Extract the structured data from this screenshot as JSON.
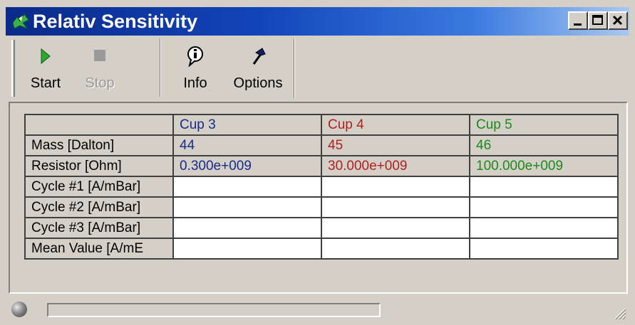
{
  "window": {
    "title": "Relativ Sensitivity",
    "controls": [
      "minimize",
      "maximize",
      "close"
    ]
  },
  "toolbar": {
    "buttons": [
      {
        "label": "Start",
        "icon": "play-icon",
        "enabled": true
      },
      {
        "label": "Stop",
        "icon": "stop-icon",
        "enabled": false
      },
      {
        "label": "Info",
        "icon": "info-icon",
        "enabled": true
      },
      {
        "label": "Options",
        "icon": "hammer-icon",
        "enabled": true
      }
    ]
  },
  "table": {
    "columns": [
      {
        "label": "Cup 3",
        "color": "#1a2a8a"
      },
      {
        "label": "Cup 4",
        "color": "#b02020"
      },
      {
        "label": "Cup 5",
        "color": "#1a8a1a"
      }
    ],
    "rows": [
      {
        "label": "Mass [Dalton]",
        "values": [
          "44",
          "45",
          "46"
        ],
        "style": "header"
      },
      {
        "label": "Resistor [Ohm]",
        "values": [
          "0.300e+009",
          "30.000e+009",
          "100.000e+009"
        ],
        "style": "header"
      },
      {
        "label": "Cycle #1  [A/mBar]",
        "values": [
          "",
          "",
          ""
        ],
        "style": "cell"
      },
      {
        "label": "Cycle #2  [A/mBar]",
        "values": [
          "",
          "",
          ""
        ],
        "style": "cell"
      },
      {
        "label": "Cycle #3  [A/mBar]",
        "values": [
          "",
          "",
          ""
        ],
        "style": "cell"
      },
      {
        "label": "Mean Value [A/mE",
        "values": [
          "",
          "",
          ""
        ],
        "style": "cell"
      }
    ]
  },
  "statusbar": {
    "progress": 0,
    "indicator": "status-led-icon"
  }
}
